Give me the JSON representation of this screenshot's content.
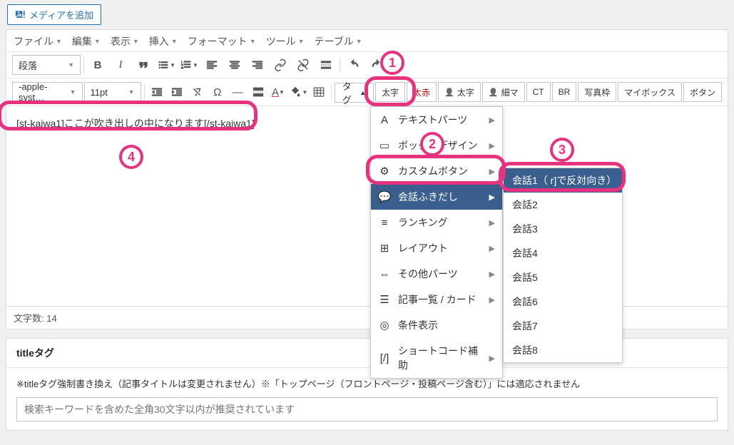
{
  "add_media_label": "メディアを追加",
  "menu": [
    "ファイル",
    "編集",
    "表示",
    "挿入",
    "フォーマット",
    "ツール",
    "テーブル"
  ],
  "row1": {
    "format_select": "段落"
  },
  "row2": {
    "font_select": "-apple-syst…",
    "size_select": "11pt",
    "tag_btn": "タグ",
    "btns": {
      "ooji": "太字",
      "ooaka": "太赤",
      "futoji": "太字",
      "hosoma": "細マ",
      "ct": "CT",
      "br": "BR",
      "shashin": "写真枠",
      "mybox": "マイボックス",
      "botan": "ボタン"
    }
  },
  "callouts": {
    "n1": "1",
    "n2": "2",
    "n3": "3",
    "n4": "4"
  },
  "shortcode_text": "[st-kaiwa1]ここが吹き出しの中になります[/st-kaiwa1]",
  "dropdown": {
    "items": [
      {
        "icon": "A",
        "label": "テキストパーツ"
      },
      {
        "icon": "▭",
        "label": "ボックスデザイン"
      },
      {
        "icon": "⚙",
        "label": "カスタムボタン"
      },
      {
        "icon": "💬",
        "label": "会話ふきだし"
      },
      {
        "icon": "≡",
        "label": "ランキング"
      },
      {
        "icon": "⊞",
        "label": "レイアウト"
      },
      {
        "icon": "⇔",
        "label": "その他パーツ"
      },
      {
        "icon": "☰",
        "label": "記事一覧 / カード"
      },
      {
        "icon": "◎",
        "label": "条件表示"
      },
      {
        "icon": "[/]",
        "label": "ショートコード補助"
      }
    ]
  },
  "submenu": {
    "items": [
      "会話1（ r]で反対向き）",
      "会話2",
      "会話3",
      "会話4",
      "会話5",
      "会話6",
      "会話7",
      "会話8"
    ]
  },
  "status": {
    "wordcount_label": "文字数:",
    "wordcount": "14"
  },
  "titlebox": {
    "heading": "titleタグ",
    "desc": "※titleタグ強制書き換え（記事タイトルは変更されません）※「トップページ（フロントページ・投稿ページ含む）」には適応されません",
    "placeholder": "検索キーワードを含めた全角30文字以内が推奨されています"
  }
}
